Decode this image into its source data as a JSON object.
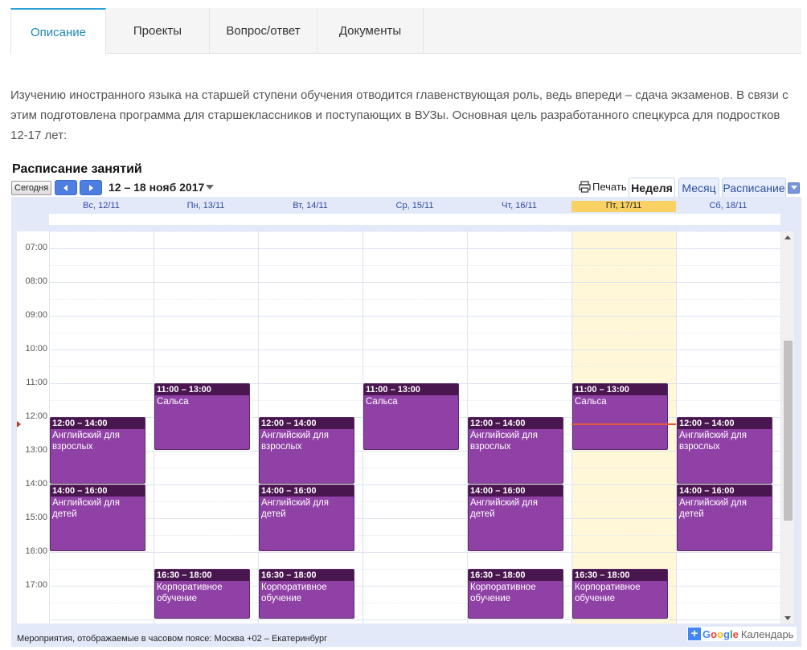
{
  "tabs": [
    {
      "label": "Описание",
      "active": true
    },
    {
      "label": "Проекты",
      "active": false
    },
    {
      "label": "Вопрос/ответ",
      "active": false
    },
    {
      "label": "Документы",
      "active": false
    }
  ],
  "description": "Изучению иностранного языка на старшей ступени обучения отводится главенствующая роль, ведь впереди – сдача экзаменов. В связи с этим подготовлена программа для старшеклассников и поступающих в ВУЗы. Основная цель разработанного спецкурса для подростков 12-17 лет:",
  "calendar": {
    "title": "Расписание занятий",
    "today_label": "Сегодня",
    "date_range": "12 – 18 нояб 2017",
    "print_label": "Печать",
    "view_tabs": [
      {
        "label": "Неделя",
        "active": true
      },
      {
        "label": "Месяц",
        "active": false
      },
      {
        "label": "Расписание",
        "active": false
      }
    ],
    "days": [
      "Вс, 12/11",
      "Пн, 13/11",
      "Вт, 14/11",
      "Ср, 15/11",
      "Чт, 16/11",
      "Пт, 17/11",
      "Сб, 18/11"
    ],
    "today_index": 5,
    "hours": [
      "07:00",
      "08:00",
      "09:00",
      "10:00",
      "11:00",
      "12:00",
      "13:00",
      "14:00",
      "15:00",
      "16:00",
      "17:00"
    ],
    "first_hour": 6.5,
    "now_hour": 12.2,
    "events": [
      {
        "day": 0,
        "start": 12.0,
        "end": 14.0,
        "time": "12:00 – 14:00",
        "name": "Английский для взрослых"
      },
      {
        "day": 0,
        "start": 14.0,
        "end": 16.0,
        "time": "14:00 – 16:00",
        "name": "Английский для детей"
      },
      {
        "day": 1,
        "start": 11.0,
        "end": 13.0,
        "time": "11:00 – 13:00",
        "name": "Сальса"
      },
      {
        "day": 1,
        "start": 16.5,
        "end": 18.0,
        "time": "16:30 – 18:00",
        "name": "Корпоративное обучение"
      },
      {
        "day": 2,
        "start": 12.0,
        "end": 14.0,
        "time": "12:00 – 14:00",
        "name": "Английский для взрослых"
      },
      {
        "day": 2,
        "start": 14.0,
        "end": 16.0,
        "time": "14:00 – 16:00",
        "name": "Английский для детей"
      },
      {
        "day": 2,
        "start": 16.5,
        "end": 18.0,
        "time": "16:30 – 18:00",
        "name": "Корпоративное обучение"
      },
      {
        "day": 3,
        "start": 11.0,
        "end": 13.0,
        "time": "11:00 – 13:00",
        "name": "Сальса"
      },
      {
        "day": 4,
        "start": 12.0,
        "end": 14.0,
        "time": "12:00 – 14:00",
        "name": "Английский для взрослых"
      },
      {
        "day": 4,
        "start": 14.0,
        "end": 16.0,
        "time": "14:00 – 16:00",
        "name": "Английский для детей"
      },
      {
        "day": 4,
        "start": 16.5,
        "end": 18.0,
        "time": "16:30 – 18:00",
        "name": "Корпоративное обучение"
      },
      {
        "day": 5,
        "start": 11.0,
        "end": 13.0,
        "time": "11:00 – 13:00",
        "name": "Сальса"
      },
      {
        "day": 5,
        "start": 16.5,
        "end": 18.0,
        "time": "16:30 – 18:00",
        "name": "Корпоративное обучение"
      },
      {
        "day": 6,
        "start": 12.0,
        "end": 14.0,
        "time": "12:00 – 14:00",
        "name": "Английский для взрослых"
      },
      {
        "day": 6,
        "start": 14.0,
        "end": 16.0,
        "time": "14:00 – 16:00",
        "name": "Английский для детей"
      }
    ],
    "timezone_note": "Мероприятия, отображаемые в часовом поясе: Москва +02 – Екатеринбург",
    "badge": {
      "google": "Google",
      "calendar": "Календарь"
    },
    "colors": {
      "event": "#9041a6",
      "event_header": "#4a1650",
      "today_bg": "#fff7d7",
      "today_header": "#fad163",
      "accent": "#2a9fd6"
    }
  }
}
